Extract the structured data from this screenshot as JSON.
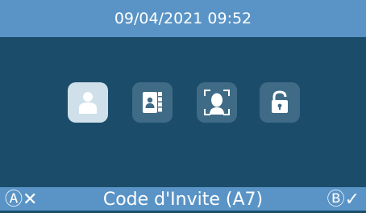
{
  "header": {
    "datetime": "09/04/2021  09:52"
  },
  "main": {
    "options": [
      {
        "icon": "user-icon",
        "selected": true
      },
      {
        "icon": "contact-book-icon",
        "selected": false
      },
      {
        "icon": "face-recognition-icon",
        "selected": false
      },
      {
        "icon": "unlock-icon",
        "selected": false
      }
    ]
  },
  "footer": {
    "left_label": "Ⓐ✕",
    "title": "Code d'Invite (A7)",
    "right_label": "Ⓑ✓"
  },
  "colors": {
    "header_bar": "#5a94c6",
    "background": "#1b4d6b",
    "tile": "#3f6b86",
    "tile_selected": "#cfe0ea"
  }
}
